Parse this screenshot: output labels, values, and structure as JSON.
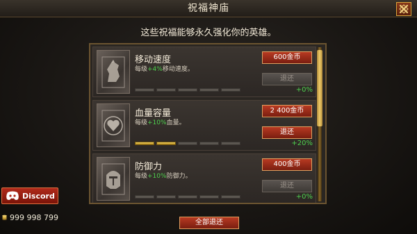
{
  "header": {
    "title": "祝福神庙"
  },
  "subtitle": "这些祝福能够永久强化你的英雄。",
  "blessings": [
    {
      "name": "移动速度",
      "desc_prefix": "每级",
      "desc_bonus": "+4%",
      "desc_suffix": "移动速度。",
      "cost": "600金币",
      "refund": "退还",
      "level": 0,
      "max_level": 5,
      "total": "+0%",
      "refund_enabled": false,
      "icon": "horse-icon"
    },
    {
      "name": "血量容量",
      "desc_prefix": "每级",
      "desc_bonus": "+10%",
      "desc_suffix": "血量。",
      "cost": "2 400金币",
      "refund": "退还",
      "level": 2,
      "max_level": 5,
      "total": "+20%",
      "refund_enabled": true,
      "icon": "heart-icon"
    },
    {
      "name": "防御力",
      "desc_prefix": "每级",
      "desc_bonus": "+10%",
      "desc_suffix": "防御力。",
      "cost": "400金币",
      "refund": "退还",
      "level": 0,
      "max_level": 5,
      "total": "+0%",
      "refund_enabled": false,
      "icon": "helmet-icon"
    }
  ],
  "footer": {
    "refund_all": "全部退还"
  },
  "discord": {
    "label": "Discord"
  },
  "wallet": {
    "coins": "999 998 799"
  },
  "colors": {
    "accent_red": "#b83a22",
    "gold": "#f0cc6a",
    "bonus_green": "#4ed04e"
  }
}
